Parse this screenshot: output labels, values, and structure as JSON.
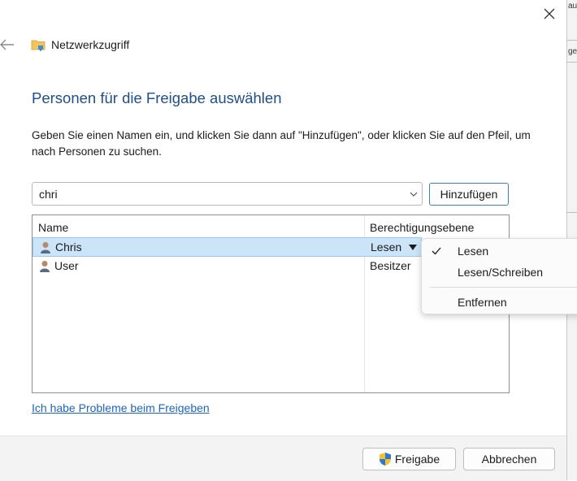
{
  "background_window": {
    "text1": "au",
    "text2": "ge"
  },
  "window": {
    "title": "Netzwerkzugriff"
  },
  "heading": "Personen für die Freigabe auswählen",
  "instructions": "Geben Sie einen Namen ein, und klicken Sie dann auf \"Hinzufügen\", oder klicken Sie auf den Pfeil, um nach Personen zu suchen.",
  "name_input": {
    "value": "chri"
  },
  "add_button": "Hinzufügen",
  "table": {
    "columns": [
      "Name",
      "Berechtigungsebene"
    ],
    "rows": [
      {
        "name": "Chris",
        "permission": "Lesen",
        "selected": true
      },
      {
        "name": "User",
        "permission": "Besitzer",
        "selected": false
      }
    ]
  },
  "permission_menu": {
    "items": [
      {
        "label": "Lesen",
        "checked": true
      },
      {
        "label": "Lesen/Schreiben",
        "checked": false
      },
      {
        "label": "Entfernen",
        "checked": false
      }
    ]
  },
  "help_link": "Ich habe Probleme beim Freigeben",
  "footer": {
    "share_button": "Freigabe",
    "cancel_button": "Abbrechen"
  },
  "colors": {
    "accent": "#1f4e8c",
    "link": "#1a66c2",
    "selection": "#cce4f7",
    "footer_bg": "#f3f3f3"
  },
  "icons": [
    "close-icon",
    "back-arrow-icon",
    "network-folder-icon",
    "user-icon",
    "dropdown-chevron-icon",
    "dropdown-caret-icon",
    "checkmark-icon",
    "uac-shield-icon"
  ]
}
